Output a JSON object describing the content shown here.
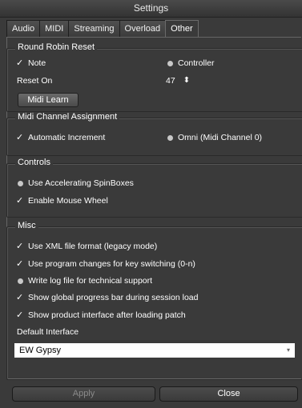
{
  "window": {
    "title": "Settings"
  },
  "tabs": [
    {
      "label": "Audio"
    },
    {
      "label": "MIDI"
    },
    {
      "label": "Streaming"
    },
    {
      "label": "Overload"
    },
    {
      "label": "Other"
    }
  ],
  "round_robin": {
    "title": "Round Robin Reset",
    "note_label": "Note",
    "controller_label": "Controller",
    "reset_on_label": "Reset On",
    "reset_on_value": "47",
    "midi_learn_label": "Midi Learn",
    "check_glyph": "✓",
    "spin_glyph": "⬍"
  },
  "midi_channel": {
    "title": "Midi Channel Assignment",
    "auto_label": "Automatic Increment",
    "omni_label": "Omni (Midi Channel 0)"
  },
  "controls": {
    "title": "Controls",
    "accel_label": "Use Accelerating SpinBoxes",
    "wheel_label": "Enable Mouse Wheel"
  },
  "misc": {
    "title": "Misc",
    "xml_label": "Use XML file format (legacy mode)",
    "progchange_label": "Use program changes for key switching (0-n)",
    "logfile_label": "Write log file for technical support",
    "progress_label": "Show global progress bar during session load",
    "product_label": "Show product interface after loading patch",
    "default_interface_label": "Default Interface",
    "default_interface_value": "EW Gypsy",
    "dropdown_glyph": "▾"
  },
  "footer": {
    "apply_label": "Apply",
    "close_label": "Close"
  },
  "colors": {
    "background": "#3a3a3a",
    "text": "#ffffff",
    "disabled_text": "#8a8a8a"
  }
}
